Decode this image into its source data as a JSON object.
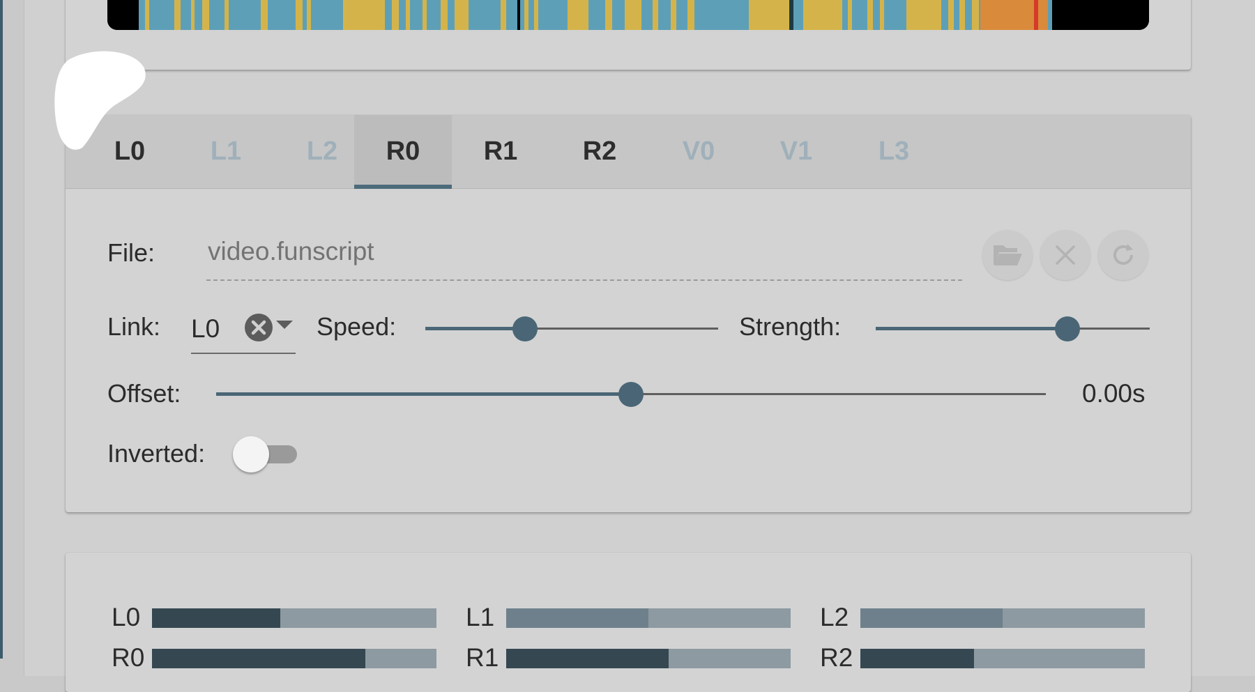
{
  "tabs": [
    {
      "label": "L0",
      "state": "enabled"
    },
    {
      "label": "L1",
      "state": "disabled"
    },
    {
      "label": "L2",
      "state": "disabled"
    },
    {
      "label": "R0",
      "state": "active"
    },
    {
      "label": "R1",
      "state": "enabled"
    },
    {
      "label": "R2",
      "state": "enabled"
    },
    {
      "label": "V0",
      "state": "disabled"
    },
    {
      "label": "V1",
      "state": "disabled"
    },
    {
      "label": "L3",
      "state": "disabled"
    }
  ],
  "file": {
    "label": "File:",
    "value": "video.funscript",
    "buttons": [
      "folder-open-icon",
      "close-icon",
      "refresh-icon"
    ]
  },
  "link": {
    "label": "Link:",
    "value": "L0"
  },
  "speed": {
    "label": "Speed:",
    "level_fraction": 0.34
  },
  "strength": {
    "label": "Strength:",
    "level_fraction": 0.7
  },
  "offset": {
    "label": "Offset:",
    "value_text": "0.00s",
    "level_fraction": 0.5
  },
  "inverted": {
    "label": "Inverted:",
    "on": false
  },
  "channel_bars": [
    {
      "label": "L0",
      "fill": 0.45,
      "color": "#354852"
    },
    {
      "label": "L1",
      "fill": 0.5,
      "color": "#6e808b"
    },
    {
      "label": "L2",
      "fill": 0.5,
      "color": "#6e808b"
    },
    {
      "label": "R0",
      "fill": 0.75,
      "color": "#354852"
    },
    {
      "label": "R1",
      "fill": 0.57,
      "color": "#354852"
    },
    {
      "label": "R2",
      "fill": 0.4,
      "color": "#354852"
    }
  ],
  "colors": {
    "accent": "#4a6676",
    "heatmap_blue": "#5e9fb8",
    "heatmap_yellow": "#d4b44a",
    "heatmap_orange": "#d98a3a",
    "heatmap_red": "#d63a2a"
  }
}
